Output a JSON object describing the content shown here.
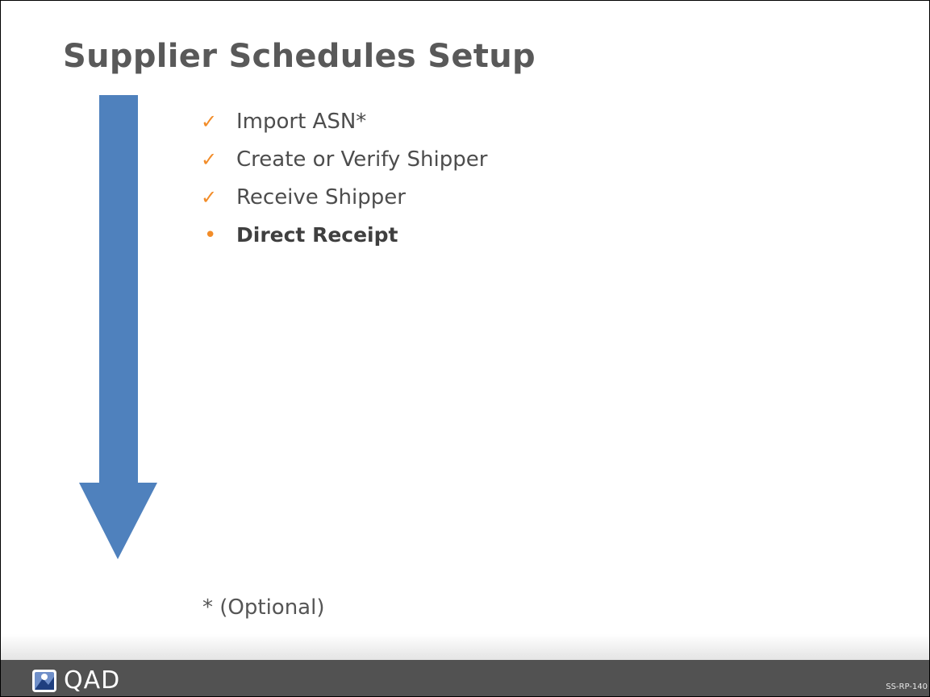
{
  "slide": {
    "title": "Supplier Schedules Setup",
    "items": [
      {
        "marker": "✓",
        "label": "Import ASN*"
      },
      {
        "marker": "✓",
        "label": "Create or Verify Shipper"
      },
      {
        "marker": "✓",
        "label": "Receive Shipper"
      },
      {
        "marker": "•",
        "label": "Direct Receipt"
      }
    ],
    "footnote": "* (Optional)"
  },
  "footer": {
    "logo_text": "QAD",
    "slide_code": "SS-RP-140"
  },
  "colors": {
    "arrow": "#4f81bd",
    "accent": "#f28c28",
    "title": "#595959",
    "footer_bg": "#525252"
  }
}
